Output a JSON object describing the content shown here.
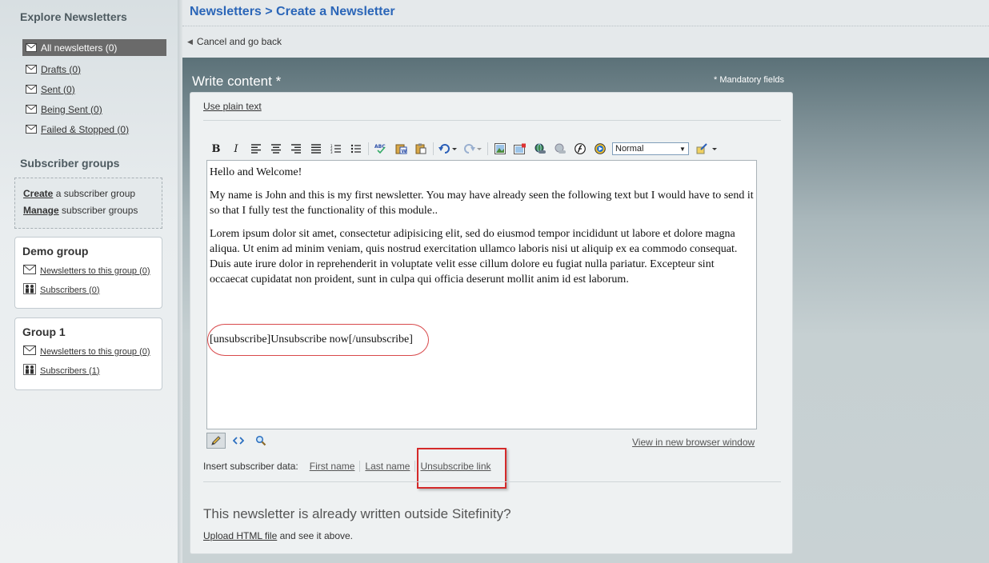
{
  "sidebar": {
    "explore_title": "Explore Newsletters",
    "newsletters": [
      {
        "label": "All newsletters (0)",
        "active": true
      },
      {
        "label": "Drafts (0)",
        "active": false
      },
      {
        "label": "Sent (0)",
        "active": false
      },
      {
        "label": "Being Sent (0)",
        "active": false
      },
      {
        "label": "Failed & Stopped (0)",
        "active": false
      }
    ],
    "subscriber_groups_title": "Subscriber groups",
    "create_link": "Create",
    "create_rest": " a subscriber group",
    "manage_link": "Manage",
    "manage_rest": " subscriber groups",
    "groups": [
      {
        "name": "Demo group",
        "newsletters_link": "Newsletters to this group (0)",
        "subscribers_link": "Subscribers (0)"
      },
      {
        "name": "Group 1",
        "newsletters_link": "Newsletters to this group (0)",
        "subscribers_link": "Subscribers (1)"
      }
    ]
  },
  "header": {
    "breadcrumb": "Newsletters > Create a Newsletter",
    "back_link": "Cancel and go back"
  },
  "main": {
    "title": "Write content *",
    "mandatory_note": "* Mandatory fields",
    "plain_text_link": "Use plain text",
    "style_select_value": "Normal",
    "editor": {
      "p1": "Hello and Welcome!",
      "p2": "My name is John and this is my first newsletter. You may have already seen the following text but I would have to send it so that I fully test the functionality of this module..",
      "p3": "Lorem ipsum dolor sit amet, consectetur adipisicing elit, sed do eiusmod tempor incididunt ut labore et dolore magna aliqua. Ut enim ad minim veniam, quis nostrud exercitation ullamco laboris nisi ut aliquip ex ea commodo consequat. Duis aute irure dolor in reprehenderit in voluptate velit esse cillum dolore eu fugiat nulla pariatur. Excepteur sint occaecat cupidatat non proident, sunt in culpa qui officia deserunt mollit anim id est laborum.",
      "unsubscribe_code": "[unsubscribe]Unsubscribe now[/unsubscribe]"
    },
    "view_new_window": "View in new browser window",
    "insert_label": "Insert subscriber data:",
    "insert_links": [
      "First name",
      "Last name",
      "Unsubscribe link"
    ],
    "outside_title": "This newsletter is already written outside Sitefinity?",
    "upload_link": "Upload HTML file",
    "upload_rest": " and see it above."
  },
  "colors": {
    "breadcrumb": "#2b66b8",
    "highlight_red": "#d42a2a",
    "active_item_bg": "#6a6a6a"
  },
  "icons": {
    "toolbar": [
      "bold-icon",
      "italic-icon",
      "align-left-icon",
      "align-center-icon",
      "align-right-icon",
      "justify-icon",
      "numbered-list-icon",
      "bullet-list-icon",
      "spellcheck-icon",
      "paste-word-icon",
      "paste-icon",
      "undo-icon",
      "redo-icon",
      "image-icon",
      "image-map-icon",
      "link-icon",
      "unlink-icon",
      "flash-icon",
      "media-icon",
      "format-stripper-icon"
    ]
  }
}
